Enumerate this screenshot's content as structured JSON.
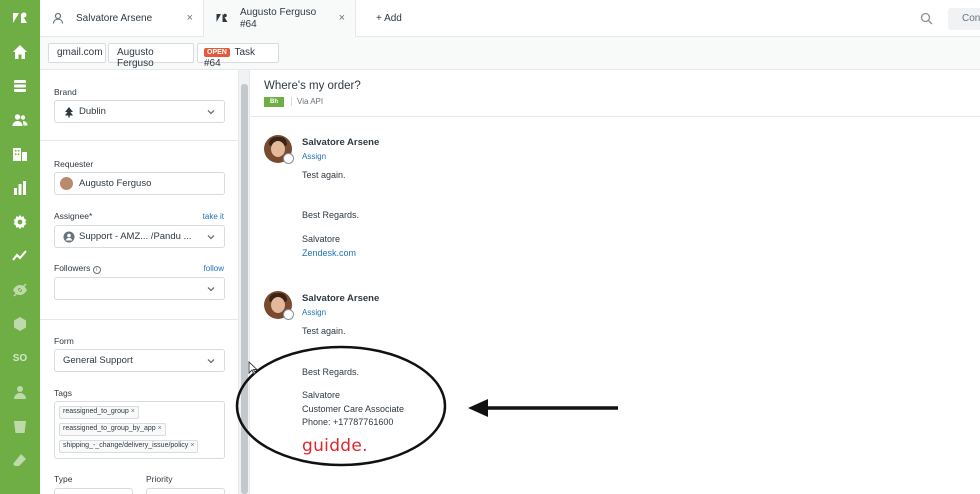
{
  "tabs": [
    {
      "label": "Salvatore Arsene",
      "close": "×"
    },
    {
      "label_line1": "Augusto Ferguso",
      "label_line2": "#64",
      "close": "×"
    }
  ],
  "add_tab_label": "+ Add",
  "top_button_label": "Con",
  "breadcrumbs": {
    "org": "gmail.com",
    "user": "Augusto Ferguso",
    "status": "OPEN",
    "task": "Task #64"
  },
  "properties": {
    "brand_label": "Brand",
    "brand_value": "Dublin",
    "requester_label": "Requester",
    "requester_value": "Augusto Ferguso",
    "assignee_label": "Assignee*",
    "assignee_link": "take it",
    "assignee_value": "Support - AMZ... /Pandu ...",
    "followers_label": "Followers",
    "followers_link": "follow",
    "form_label": "Form",
    "form_value": "General Support",
    "tags_label": "Tags",
    "tags": [
      "reassigned_to_group",
      "reassigned_to_group_by_app",
      "shipping_-_change/delivery_issue/policy"
    ],
    "type_label": "Type",
    "priority_label": "Priority"
  },
  "conversation": {
    "subject": "Where's my order?",
    "channel_badge": "Bh",
    "via": "Via API",
    "messages": [
      {
        "author": "Salvatore Arsene",
        "assign": "Assign",
        "lines": [
          "Test again.",
          "Best Regards.",
          "Salvatore"
        ],
        "link": "Zendesk.com"
      },
      {
        "author": "Salvatore Arsene",
        "assign": "Assign",
        "lines": [
          "Test again.",
          "Best Regards.",
          "Salvatore",
          "Customer Care Associate",
          "Phone: +17787761600"
        ]
      }
    ]
  },
  "watermark": "guidde.",
  "colors": {
    "rail": "#6fae45",
    "link": "#1f73b7",
    "open_badge": "#e35b3c",
    "watermark": "#e1262d"
  },
  "icons": {
    "rail": [
      "zendesk-logo-icon",
      "home-icon",
      "views-icon",
      "customers-icon",
      "organizations-icon",
      "reporting-icon",
      "settings-icon",
      "activity-icon",
      "hidden-app-icon",
      "app-icon",
      "so-app-icon",
      "user-app-icon",
      "bucket-app-icon",
      "eraser-app-icon"
    ]
  }
}
